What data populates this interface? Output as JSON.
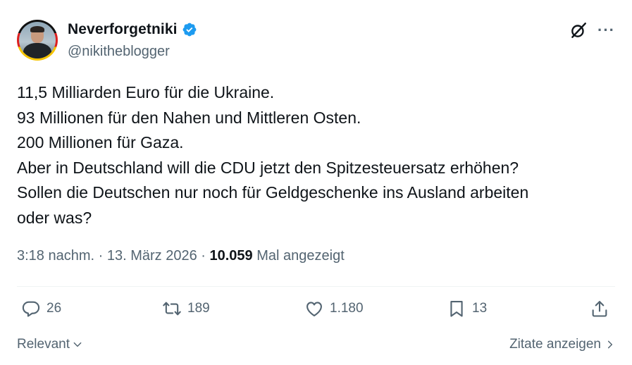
{
  "author": {
    "display_name": "Neverforgetniki",
    "handle": "@nikitheblogger",
    "verified": true
  },
  "tweet": {
    "lines": [
      "11,5 Milliarden Euro für die Ukraine.",
      "93 Millionen für den Nahen und Mittleren Osten.",
      "200 Millionen für Gaza.",
      "Aber in Deutschland will die CDU jetzt den Spitzesteuersatz erhöhen?",
      "Sollen die Deutschen nur noch für Geldgeschenke ins Ausland arbeiten",
      "oder was?"
    ]
  },
  "meta": {
    "time": "3:18 nachm.",
    "separator": " · ",
    "date": "13. März 2026",
    "views_count": "10.059",
    "views_label": " Mal angezeigt"
  },
  "actions": {
    "replies": "26",
    "reposts": "189",
    "likes": "1.180",
    "bookmarks": "13"
  },
  "footer": {
    "sort_label": "Relevant",
    "quotes_label": "Zitate anzeigen"
  },
  "colors": {
    "verified_blue": "#1d9bf0",
    "secondary_text": "#536471",
    "primary_text": "#0f1419"
  },
  "icons": [
    "grok-icon",
    "more-icon",
    "reply-icon",
    "repost-icon",
    "like-icon",
    "bookmark-icon",
    "share-icon",
    "chevron-down-icon",
    "chevron-right-icon",
    "verified-icon"
  ]
}
